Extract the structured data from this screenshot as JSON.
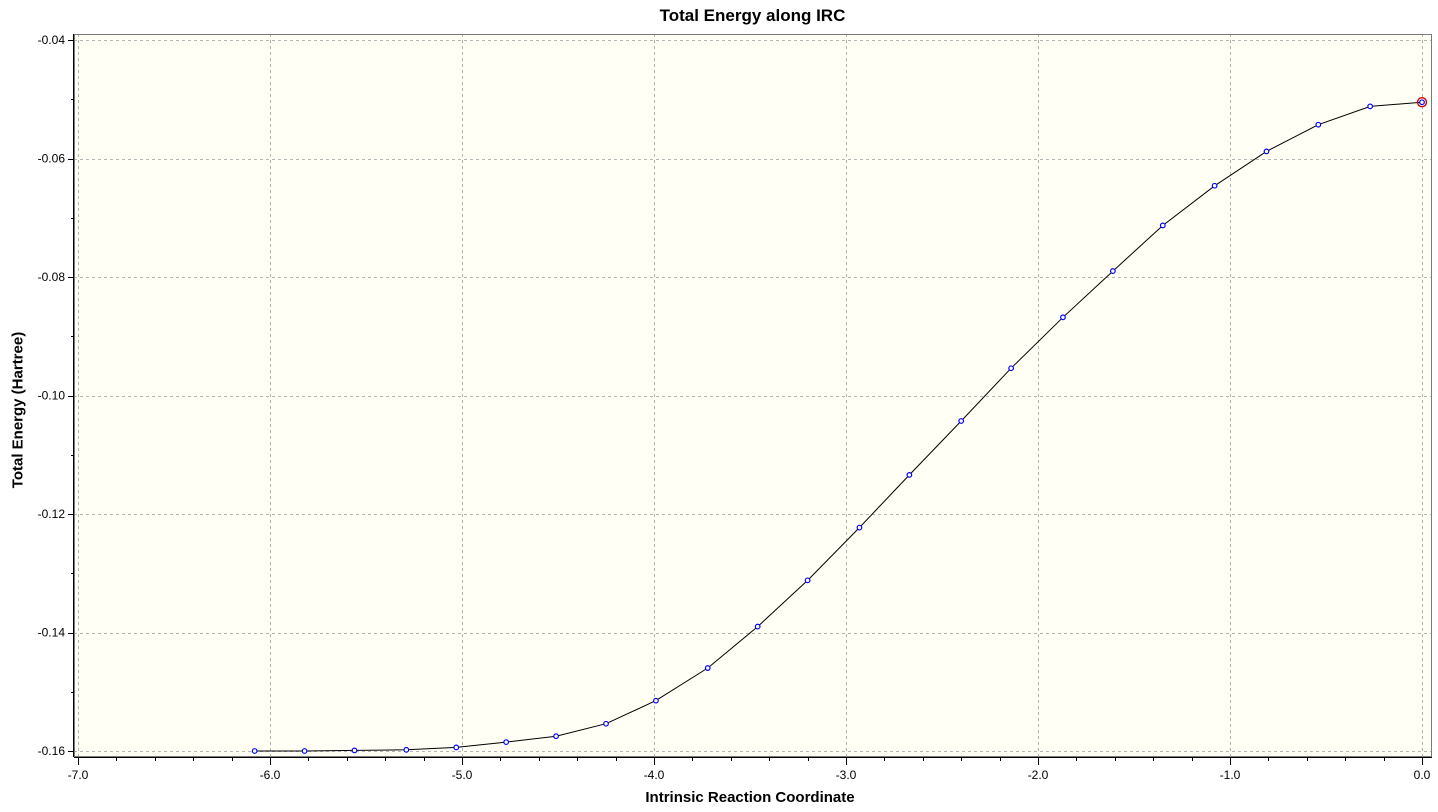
{
  "chart_data": {
    "type": "line",
    "title": "Total Energy along IRC",
    "xlabel": "Intrinsic Reaction Coordinate",
    "ylabel": "Total Energy (Hartree)",
    "xlim": [
      -7.0,
      0.0
    ],
    "ylim": [
      -0.161,
      -0.04
    ],
    "x_ticks": [
      -7.0,
      -6.0,
      -5.0,
      -4.0,
      -3.0,
      -2.0,
      -1.0,
      0.0
    ],
    "x_tick_labels": [
      "-7.0",
      "-6.0",
      "-5.0",
      "-4.0",
      "-3.0",
      "-2.0",
      "-1.0",
      "0.0"
    ],
    "y_ticks": [
      -0.16,
      -0.14,
      -0.12,
      -0.1,
      -0.08,
      -0.06,
      -0.04
    ],
    "y_tick_labels": [
      "-0.16",
      "-0.14",
      "-0.12",
      "-0.10",
      "-0.08",
      "-0.06",
      "-0.04"
    ],
    "grid": true,
    "plot_background": "#fffff5",
    "line_color": "#000000",
    "marker_color": "#0000ff",
    "highlight_color": "#d00000",
    "series": [
      {
        "x": [
          -6.08,
          -5.82,
          -5.56,
          -5.29,
          -5.03,
          -4.77,
          -4.51,
          -4.25,
          -3.99,
          -3.72,
          -3.46,
          -3.2,
          -2.93,
          -2.67,
          -2.4,
          -2.14,
          -1.87,
          -1.61,
          -1.35,
          -1.08,
          -0.81,
          -0.54,
          -0.27,
          0.0
        ],
        "y": [
          -0.16,
          -0.16,
          -0.1599,
          -0.1598,
          -0.1594,
          -0.1585,
          -0.1575,
          -0.1554,
          -0.1515,
          -0.146,
          -0.139,
          -0.1312,
          -0.1223,
          -0.1134,
          -0.1043,
          -0.0954,
          -0.0868,
          -0.079,
          -0.0713,
          -0.0646,
          -0.0588,
          -0.0543,
          -0.0512,
          -0.0505
        ]
      }
    ],
    "highlighted_point": {
      "x": 0.0,
      "y": -0.0505
    }
  }
}
